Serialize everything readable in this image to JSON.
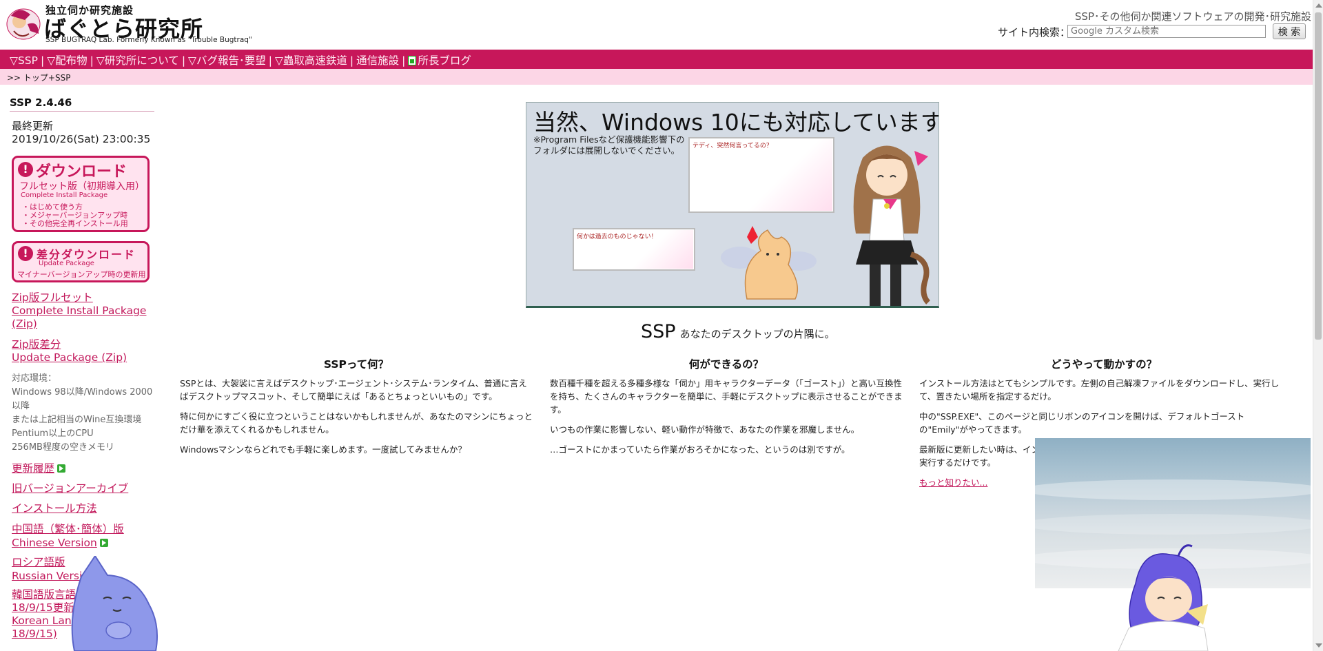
{
  "header": {
    "logo_sub": "独立伺か研究施設",
    "logo_title": "ばぐとら研究所",
    "logo_en": "SSP BUGTRAQ Lab. Formerly Known as \"Trouble Bugtraq\"",
    "tagline": "SSP･その他伺か関連ソフトウェアの開発･研究施設",
    "search_label": "サイト内検索：",
    "search_placeholder": "Google カスタム検索",
    "search_button": "検 索"
  },
  "nav": {
    "items": [
      "▽SSP",
      "▽配布物",
      "▽研究所について",
      "▽バグ報告･要望",
      "▽蟲取高速鉄道",
      "通信施設",
      "所長ブログ"
    ],
    "separator": "|"
  },
  "breadcrumb": ">> トップ+SSP",
  "sidebar": {
    "version": "SSP 2.4.46",
    "updated_label": "最終更新",
    "updated_date": "2019/10/26(Sat) 23:00:35",
    "download_full": {
      "title": "ダウンロード",
      "subtitle": "フルセット版（初期導入用）",
      "en": "Complete Install Package",
      "bullets": [
        "・はじめて使う方",
        "・メジャーバージョンアップ時",
        "・その他完全再インストール用"
      ]
    },
    "download_diff": {
      "title": "差分ダウンロード",
      "en": "Update Package",
      "note": "マイナーバージョンアップ時の更新用"
    },
    "zip_full": [
      "Zip版フルセット",
      "Complete Install Package",
      "(Zip)"
    ],
    "zip_diff": [
      "Zip版差分",
      "Update Package (Zip)"
    ],
    "requirements": [
      "対応環境：",
      "Windows 98以降/Windows 2000",
      "以降",
      "または上記相当のWine互換環境",
      "Pentium以上のCPU",
      "256MB程度の空きメモリ"
    ],
    "links": {
      "history": "更新履歴",
      "archive": "旧バージョンアーカイブ",
      "install": "インストール方法",
      "chinese": [
        "中国語（繁体･簡体）版",
        "Chinese Version"
      ],
      "russian": [
        "ロシア語版",
        "Russian Versio"
      ],
      "korean": [
        "韓国語版言語",
        "18/9/15更新",
        "Korean Lan",
        "18/9/15)"
      ]
    }
  },
  "banner": {
    "heading": "当然、Windows 10にも対応しています。",
    "note": "※Program Filesなど保護機能影響下のフォルダには展開しないでください。",
    "balloon1": "テディ、突然何言ってるの？",
    "balloon2": "何かは過去のものじゃない！"
  },
  "tagline": {
    "big": "SSP",
    "small": "あなたのデスクトップの片隅に。"
  },
  "columns": [
    {
      "title": "SSPって何？",
      "paragraphs": [
        "SSPとは、大袈裟に言えばデスクトップ･エージェント･システム･ランタイム、普通に言えばデスクトップマスコット、そして簡単にえば「あるとちょっといいもの」です。",
        "特に何かにすごく役に立つということはないかもしれませんが、あなたのマシンにちょっとだけ華を添えてくれるかもしれません。",
        "Windowsマシンならどれでも手軽に楽しめます。一度試してみませんか？"
      ]
    },
    {
      "title": "何ができるの？",
      "paragraphs": [
        "数百種千種を超える多種多様な「伺か」用キャラクターデータ（「ゴースト」）と高い互換性を持ち、たくさんのキャラクターを簡単に、手軽にデスクトップに表示させることができます。",
        "いつもの作業に影響しない、軽い動作が特徴で、あなたの作業を邪魔しません。",
        "…ゴーストにかまっていたら作業がおろそかになった、というのは別ですが。"
      ]
    },
    {
      "title": "どうやって動かすの？",
      "paragraphs": [
        "インストール方法はとてもシンプルです。左側の自己解凍ファイルをダウンロードし、実行して、置きたい場所を指定するだけ。",
        "中の\"SSP.EXE\"、このページと同じリボンのアイコンを開けば、デフォルトゴーストの\"Emily\"がやってきます。",
        "最新版に更新したい時は、イン",
        "実行するだけです。"
      ],
      "more": "もっと知りたい..."
    }
  ],
  "colors": {
    "accent": "#c7175a",
    "breadcrumb_bg": "#fcd6e6",
    "link": "#c2185b"
  }
}
